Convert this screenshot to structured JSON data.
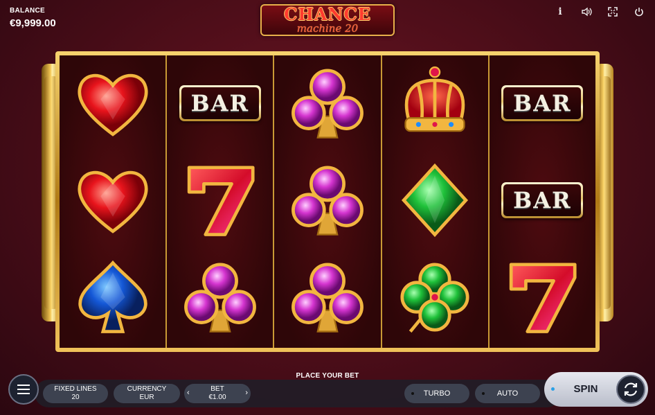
{
  "balance": {
    "label": "BALANCE",
    "value": "€9,999.00"
  },
  "logo": {
    "line1": "CHANCE",
    "line2": "machine 20"
  },
  "top_icons": [
    "info-icon",
    "sound-icon",
    "fullscreen-icon",
    "power-icon"
  ],
  "reels": [
    [
      "red-heart",
      "red-heart",
      "blue-spade"
    ],
    [
      "bar",
      "seven",
      "pink-club"
    ],
    [
      "pink-club",
      "pink-club",
      "pink-club"
    ],
    [
      "crown",
      "green-diamond",
      "green-clover"
    ],
    [
      "bar",
      "bar",
      "seven"
    ]
  ],
  "bar_text": "BAR",
  "controls": {
    "place_bet": "PLACE YOUR BET",
    "fixed_lines_label": "FIXED LINES",
    "fixed_lines_value": "20",
    "currency_label": "CURRENCY",
    "currency_value": "EUR",
    "bet_label": "BET",
    "bet_value": "€1.00",
    "turbo": "TURBO",
    "auto": "AUTO",
    "spin": "SPIN"
  },
  "colors": {
    "accent": "#2aa0e6",
    "gold": "#e8b04a",
    "background": "#4a0d18"
  }
}
